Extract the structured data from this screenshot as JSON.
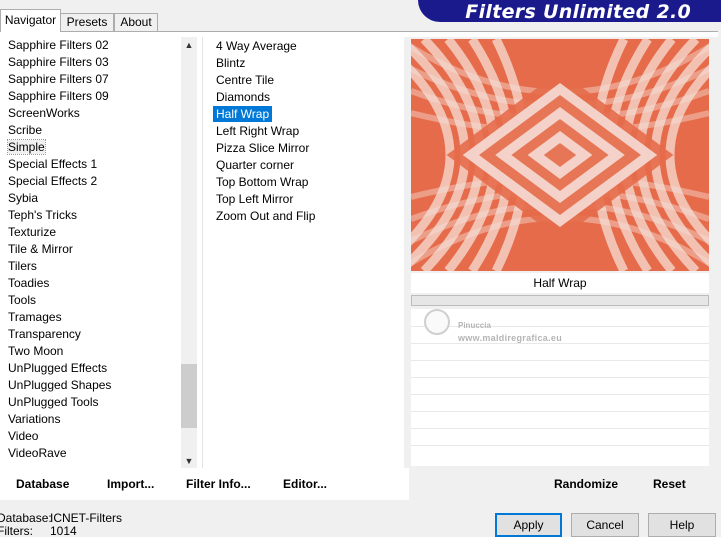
{
  "tabs": [
    {
      "label": "Navigator",
      "active": true
    },
    {
      "label": "Presets",
      "active": false
    },
    {
      "label": "About",
      "active": false
    }
  ],
  "banner": {
    "title": "Filters Unlimited 2.0",
    "color": "#1a1a8c"
  },
  "categories": [
    "Sapphire Filters 02",
    "Sapphire Filters 03",
    "Sapphire Filters 07",
    "Sapphire Filters 09",
    "ScreenWorks",
    "Scribe",
    "Simple",
    "Special Effects 1",
    "Special Effects 2",
    "Sybia",
    "Teph's Tricks",
    "Texturize",
    "Tile & Mirror",
    "Tilers",
    "Toadies",
    "Tools",
    "Tramages",
    "Transparency",
    "Two Moon",
    "UnPlugged Effects",
    "UnPlugged Shapes",
    "UnPlugged Tools",
    "Variations",
    "Video",
    "VideoRave"
  ],
  "selected_category": "Simple",
  "filters": [
    "4 Way Average",
    "Blintz",
    "Centre Tile",
    "Diamonds",
    "Half Wrap",
    "Left Right Wrap",
    "Pizza Slice Mirror",
    "Quarter corner",
    "Top Bottom Wrap",
    "Top Left Mirror",
    "Zoom Out and Flip"
  ],
  "selected_filter": "Half Wrap",
  "preview": {
    "filter_name": "Half Wrap",
    "colors": {
      "primary": "#e66b4a",
      "light": "#f5ddd6"
    }
  },
  "watermark": {
    "line1": "Pinuccia",
    "line2": "www.maldiregrafica.eu"
  },
  "toolbar": {
    "database": "Database",
    "import": "Import...",
    "filter_info": "Filter Info...",
    "editor": "Editor...",
    "randomize": "Randomize",
    "reset": "Reset"
  },
  "status": {
    "database_label": "Database:",
    "database_value": "ICNET-Filters",
    "filters_label": "Filters:",
    "filters_value": "1014"
  },
  "buttons": {
    "apply": "Apply",
    "cancel": "Cancel",
    "help": "Help"
  },
  "icons": {
    "scroll_up": "triangle-up-icon",
    "scroll_down": "triangle-down-icon"
  },
  "colors": {
    "selection": "#0078d7",
    "banner": "#1a1a8c"
  }
}
